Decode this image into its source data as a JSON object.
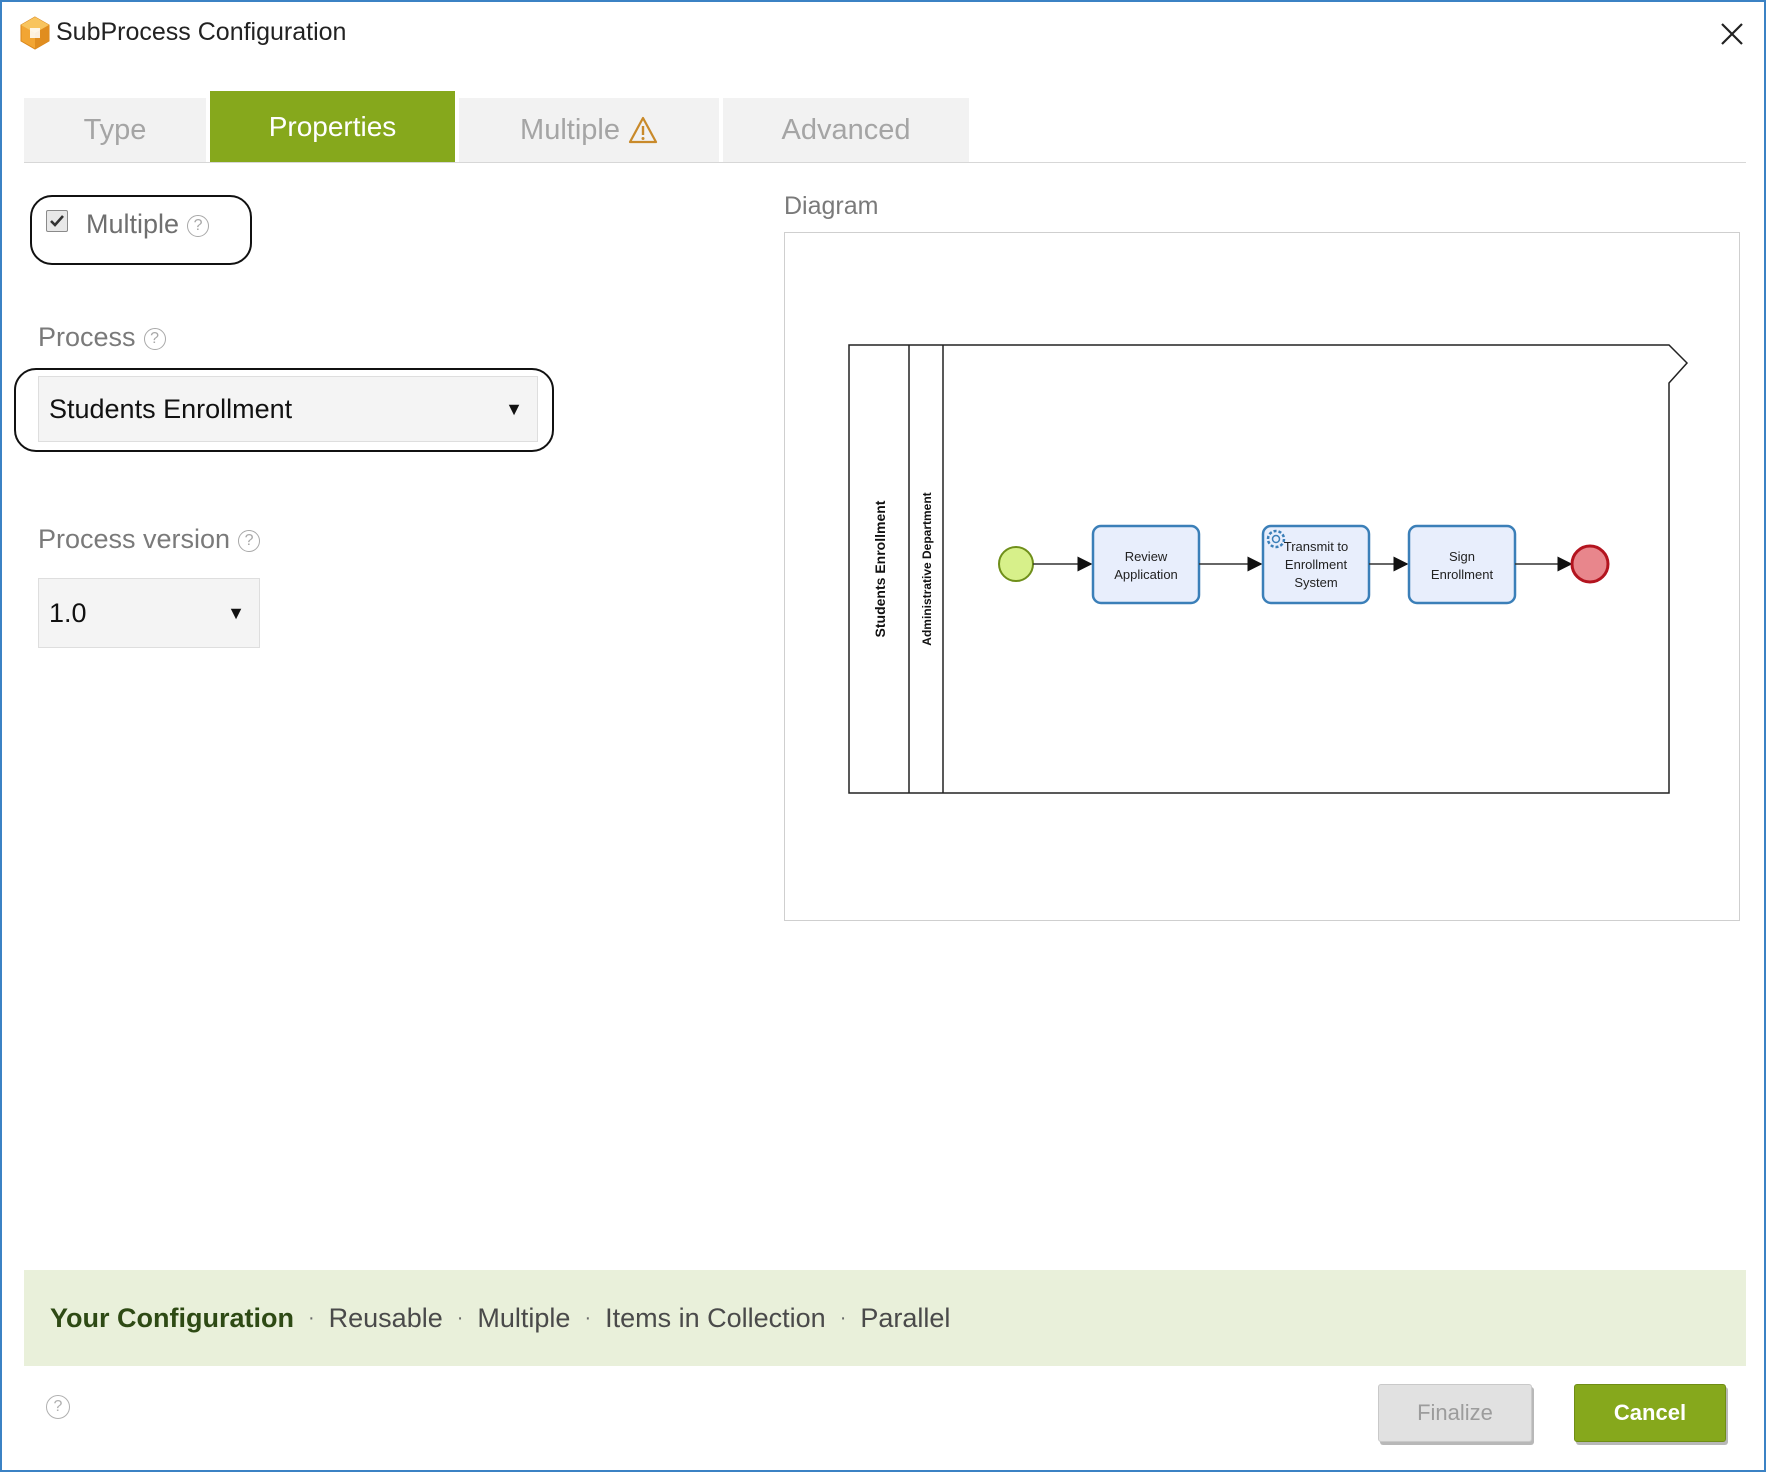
{
  "window": {
    "title": "SubProcess Configuration"
  },
  "tabs": [
    {
      "label": "Type",
      "active": false
    },
    {
      "label": "Properties",
      "active": true
    },
    {
      "label": "Multiple",
      "active": false,
      "warning": true
    },
    {
      "label": "Advanced",
      "active": false
    }
  ],
  "form": {
    "multiple": {
      "label": "Multiple",
      "checked": true
    },
    "process": {
      "label": "Process",
      "value": "Students Enrollment"
    },
    "process_version": {
      "label": "Process version",
      "value": "1.0"
    }
  },
  "diagram": {
    "label": "Diagram",
    "pool_label": "Students Enrollment",
    "lane_label": "Administrative Department",
    "tasks": [
      {
        "line1": "Review",
        "line2": "Application",
        "line3": ""
      },
      {
        "line1": "Transmit to",
        "line2": "Enrollment",
        "line3": "System"
      },
      {
        "line1": "Sign",
        "line2": "Enrollment",
        "line3": ""
      }
    ]
  },
  "configuration": {
    "heading": "Your Configuration",
    "items": [
      "Reusable",
      "Multiple",
      "Items in Collection",
      "Parallel"
    ]
  },
  "footer": {
    "finalize_label": "Finalize",
    "cancel_label": "Cancel"
  },
  "colors": {
    "accent_green": "#86a81c",
    "window_border": "#3b82c4",
    "config_background": "#e9f0da",
    "start_event": "#d7f08a",
    "end_event": "#e8868c",
    "task_fill": "#e8eefc",
    "task_border": "#3b7fb8"
  },
  "icons": {
    "app": "app-cube-icon",
    "close": "close-icon",
    "warning": "warning-triangle-icon",
    "help": "help-question-icon",
    "dropdown": "dropdown-caret-icon",
    "checkmark": "checkmark-icon",
    "service_task": "gear-icon"
  }
}
